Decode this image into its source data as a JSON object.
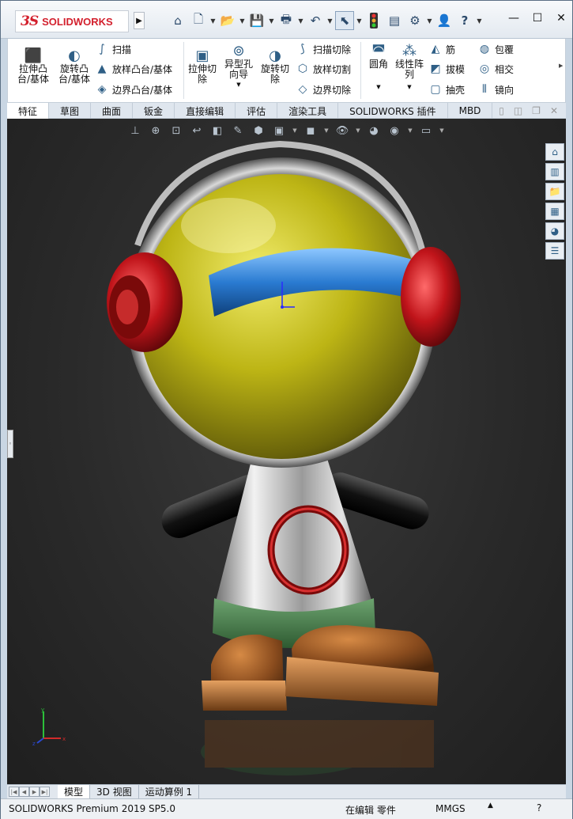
{
  "brand": {
    "mark": "3S",
    "name": "SOLIDWORKS"
  },
  "quick_access": [
    {
      "name": "home-icon",
      "glyph": "⌂"
    },
    {
      "name": "new-document-icon",
      "glyph": "🗋"
    },
    {
      "name": "open-icon",
      "glyph": "📂"
    },
    {
      "name": "save-icon",
      "glyph": "💾"
    },
    {
      "name": "print-icon",
      "glyph": "🖶"
    },
    {
      "name": "undo-icon",
      "glyph": "↶"
    },
    {
      "name": "select-icon",
      "glyph": "⬉"
    },
    {
      "name": "traffic-light-icon",
      "glyph": "🚦"
    },
    {
      "name": "file-properties-icon",
      "glyph": "▤"
    },
    {
      "name": "options-gear-icon",
      "glyph": "⚙"
    },
    {
      "name": "help-icon",
      "glyph": "?"
    },
    {
      "name": "user-icon",
      "glyph": "👤"
    }
  ],
  "window_controls": {
    "minimize": "—",
    "maximize": "☐",
    "close": "✕"
  },
  "ribbon": {
    "extrude_boss": "拉伸凸\n台/基体",
    "revolve_boss": "旋转凸\n台/基体",
    "sweep": "扫描",
    "loft_boss": "放样凸台/基体",
    "boundary_boss": "边界凸台/基体",
    "extrude_cut": "拉伸切\n除",
    "hole_wizard": "异型孔\n向导",
    "revolve_cut": "旋转切\n除",
    "swept_cut": "扫描切除",
    "lofted_cut": "放样切割",
    "boundary_cut": "边界切除",
    "fillet": "圆角",
    "linear_pattern": "线性阵\n列",
    "rib": "筋",
    "draft": "拔模",
    "shell": "抽壳",
    "wrap": "包覆",
    "intersect": "相交",
    "mirror": "镜向"
  },
  "tabs": [
    "特征",
    "草图",
    "曲面",
    "钣金",
    "直接编辑",
    "评估",
    "渲染工具",
    "SOLIDWORKS 插件",
    "MBD"
  ],
  "active_tab": "特征",
  "model_tabs": [
    "模型",
    "3D 视图",
    "运动算例 1"
  ],
  "status": {
    "product": "SOLIDWORKS Premium 2019 SP5.0",
    "mode": "在编辑 零件",
    "units": "MMGS",
    "units_dropdown": "▲",
    "help": "?"
  },
  "colors": {
    "brand_red": "#d3202d",
    "viewport_bg": "#262626",
    "helmet_yellow": "#c9c21c",
    "visor_blue": "#2f7fd0",
    "ear_red": "#c0141a",
    "body_silver": "#c7c7c7",
    "belt_green": "#5a8a5c",
    "boot_brown": "#a8612c"
  }
}
